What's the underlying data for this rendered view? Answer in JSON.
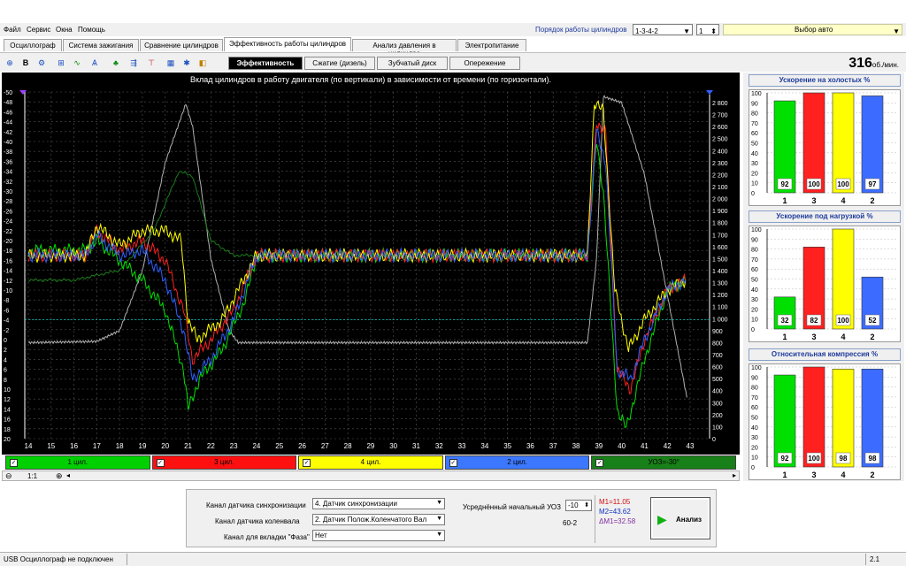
{
  "menu": [
    "Файл",
    "Сервис",
    "Окна",
    "Помощь"
  ],
  "cylinder_order": {
    "label": "Порядок работы цилиндров",
    "value": "1-3-4-2",
    "spin": "1"
  },
  "car_select": "Выбор авто",
  "tabs": [
    "Осциллограф",
    "Система зажигания",
    "Сравнение цилиндров",
    "Эффективность работы цилиндров",
    "Анализ давления в цилиндре",
    "Электропитание"
  ],
  "active_tab": 3,
  "subtabs": [
    "Эффективность",
    "Сжатие (дизель)",
    "Зубчатый диск",
    "Опережение"
  ],
  "rpm": {
    "value": "316",
    "unit": "об./мин."
  },
  "plot": {
    "title": "Вклад цилиндров в работу двигателя (по вертикали) в зависимости от времени (по горизонтали).",
    "left_ticks": [
      "-50",
      "-48",
      "-46",
      "-44",
      "-42",
      "-40",
      "-38",
      "-36",
      "-34",
      "-32",
      "-30",
      "-28",
      "-26",
      "-24",
      "-22",
      "-20",
      "-18",
      "-16",
      "-14",
      "-12",
      "-10",
      "-8",
      "-6",
      "-4",
      "-2",
      "0",
      "2",
      "4",
      "6",
      "8",
      "10",
      "12",
      "14",
      "16",
      "18",
      "20"
    ],
    "right_ticks": [
      "2 800",
      "2 700",
      "2 600",
      "2 500",
      "2 400",
      "2 300",
      "2 200",
      "2 100",
      "2 000",
      "1 900",
      "1 800",
      "1 700",
      "1 600",
      "1 500",
      "1 400",
      "1 300",
      "1 200",
      "1 100",
      "1 000",
      "900",
      "800",
      "700",
      "600",
      "500",
      "400",
      "300",
      "200",
      "100",
      "0"
    ],
    "x_ticks": [
      "14",
      "15",
      "16",
      "17",
      "18",
      "19",
      "20",
      "21",
      "22",
      "23",
      "24",
      "25",
      "26",
      "27",
      "28",
      "29",
      "30",
      "31",
      "32",
      "33",
      "34",
      "35",
      "36",
      "37",
      "38",
      "39",
      "40",
      "41",
      "42",
      "43"
    ],
    "colors": {
      "c1": "#00e000",
      "c3": "#ff2020",
      "c4": "#ffff00",
      "c2": "#3060ff",
      "rpm": "#b0b0b0",
      "uoz": "#1a7a1a",
      "ref": "#00c0c0"
    }
  },
  "legend": [
    {
      "label": "1 цил.",
      "color": "#00d000",
      "check": "✓"
    },
    {
      "label": "3 цил.",
      "color": "#ff1010",
      "check": "✓"
    },
    {
      "label": "4 цил.",
      "color": "#ffff00",
      "check": "✓"
    },
    {
      "label": "2 цил.",
      "color": "#3c78ff",
      "check": "✓"
    },
    {
      "label": "УОЗ=-30°",
      "color": "#188018",
      "check": "✓"
    }
  ],
  "zoom": "1:1",
  "panels": [
    {
      "title": "Ускорение на холостых %",
      "bars": [
        {
          "cyl": "1",
          "value": 92,
          "color": "#00e000"
        },
        {
          "cyl": "3",
          "value": 100,
          "color": "#ff2020"
        },
        {
          "cyl": "4",
          "value": 100,
          "color": "#ffff00"
        },
        {
          "cyl": "2",
          "value": 97,
          "color": "#3c6cff"
        }
      ]
    },
    {
      "title": "Ускорение под нагрузкой %",
      "bars": [
        {
          "cyl": "1",
          "value": 32,
          "color": "#00e000"
        },
        {
          "cyl": "3",
          "value": 82,
          "color": "#ff2020"
        },
        {
          "cyl": "4",
          "value": 100,
          "color": "#ffff00"
        },
        {
          "cyl": "2",
          "value": 52,
          "color": "#3c6cff"
        }
      ]
    },
    {
      "title": "Относительная компрессия %",
      "bars": [
        {
          "cyl": "1",
          "value": 92,
          "color": "#00e000"
        },
        {
          "cyl": "3",
          "value": 100,
          "color": "#ff2020"
        },
        {
          "cyl": "4",
          "value": 98,
          "color": "#ffff00"
        },
        {
          "cyl": "2",
          "value": 98,
          "color": "#3c6cff"
        }
      ]
    }
  ],
  "panel_ticks": [
    "100",
    "90",
    "80",
    "70",
    "60",
    "50",
    "40",
    "30",
    "20",
    "10",
    "0"
  ],
  "bottom": {
    "sync_label": "Канал датчика синхронизации",
    "sync_value": "4. Датчик синхронизации",
    "crank_label": "Канал датчика коленвала",
    "crank_value": "2. Датчик Полож.Коленчатого Вал",
    "phase_label": "Канал для вкладки \"Фаза\"",
    "phase_value": "Нет",
    "uoz_label": "Усреднённый начальный УОЗ",
    "uoz_value": "-10",
    "wheel": "60-2",
    "m1": "M1=11.05",
    "m2": "M2=43.62",
    "dm": "ΔM1=32.58",
    "analyze": "Анализ"
  },
  "status": {
    "left": "USB Осциллограф не подключен",
    "right": "2.1"
  }
}
